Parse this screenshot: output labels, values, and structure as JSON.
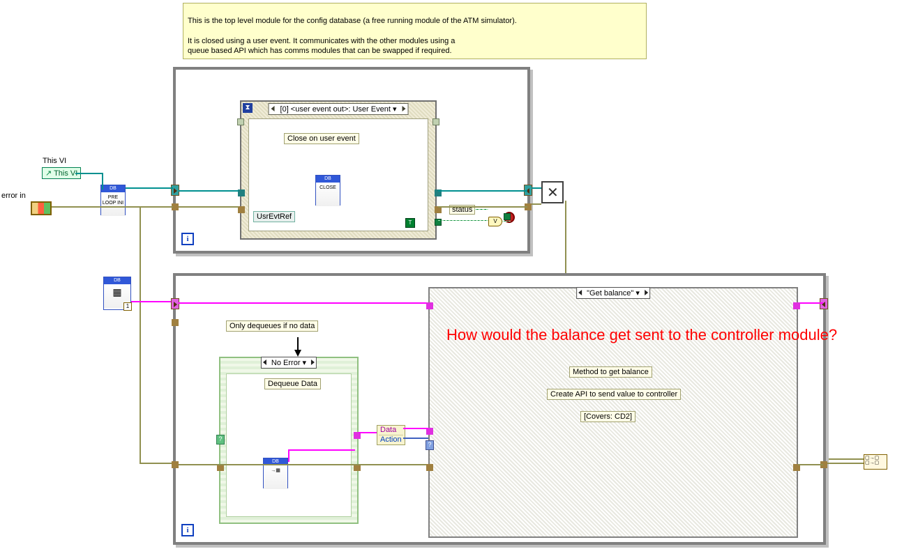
{
  "comment_top": "This is the top level module for the config database (a free running module of the ATM simulator).\n\nIt is closed using a user event. It communicates with the other modules using a\nqueue based API which has comms modules that can be swapped if required.",
  "this_vi_label": "This VI",
  "this_vi_ref": "This VI",
  "error_in_label": "error in",
  "subvi_pre": {
    "hdr": "DB",
    "body": "PRE\nLOOP INI"
  },
  "subvi_close": {
    "hdr": "DB",
    "body": "CLOSE"
  },
  "subvi_db1": {
    "hdr": "DB",
    "body1": "■■",
    "badge": "1"
  },
  "subvi_dq": {
    "hdr": "DB",
    "body": "→■"
  },
  "event_case_label": "[0] <user event out>: User Event ▾",
  "close_on_event": "Close on user event",
  "usr_evt_ref": "UsrEvtRef",
  "status_label": "status",
  "bool_true": "T",
  "or_label": "V",
  "only_dequeues": "Only dequeues if no data",
  "no_error_case": "No Error ▾",
  "dequeue_data": "Dequeue Data",
  "data_action_1": "Data",
  "data_action_2": "Action",
  "get_balance_case": "\"Get balance\"          ▾",
  "annotation_red": "How would the balance get sent to the controller module?",
  "method_get_balance": "Method to get balance",
  "create_api": "Create API to send value to controller",
  "covers": "[Covers: CD2]",
  "merge_errors": "▢→▢\n▢→▢",
  "loop_i": "i"
}
